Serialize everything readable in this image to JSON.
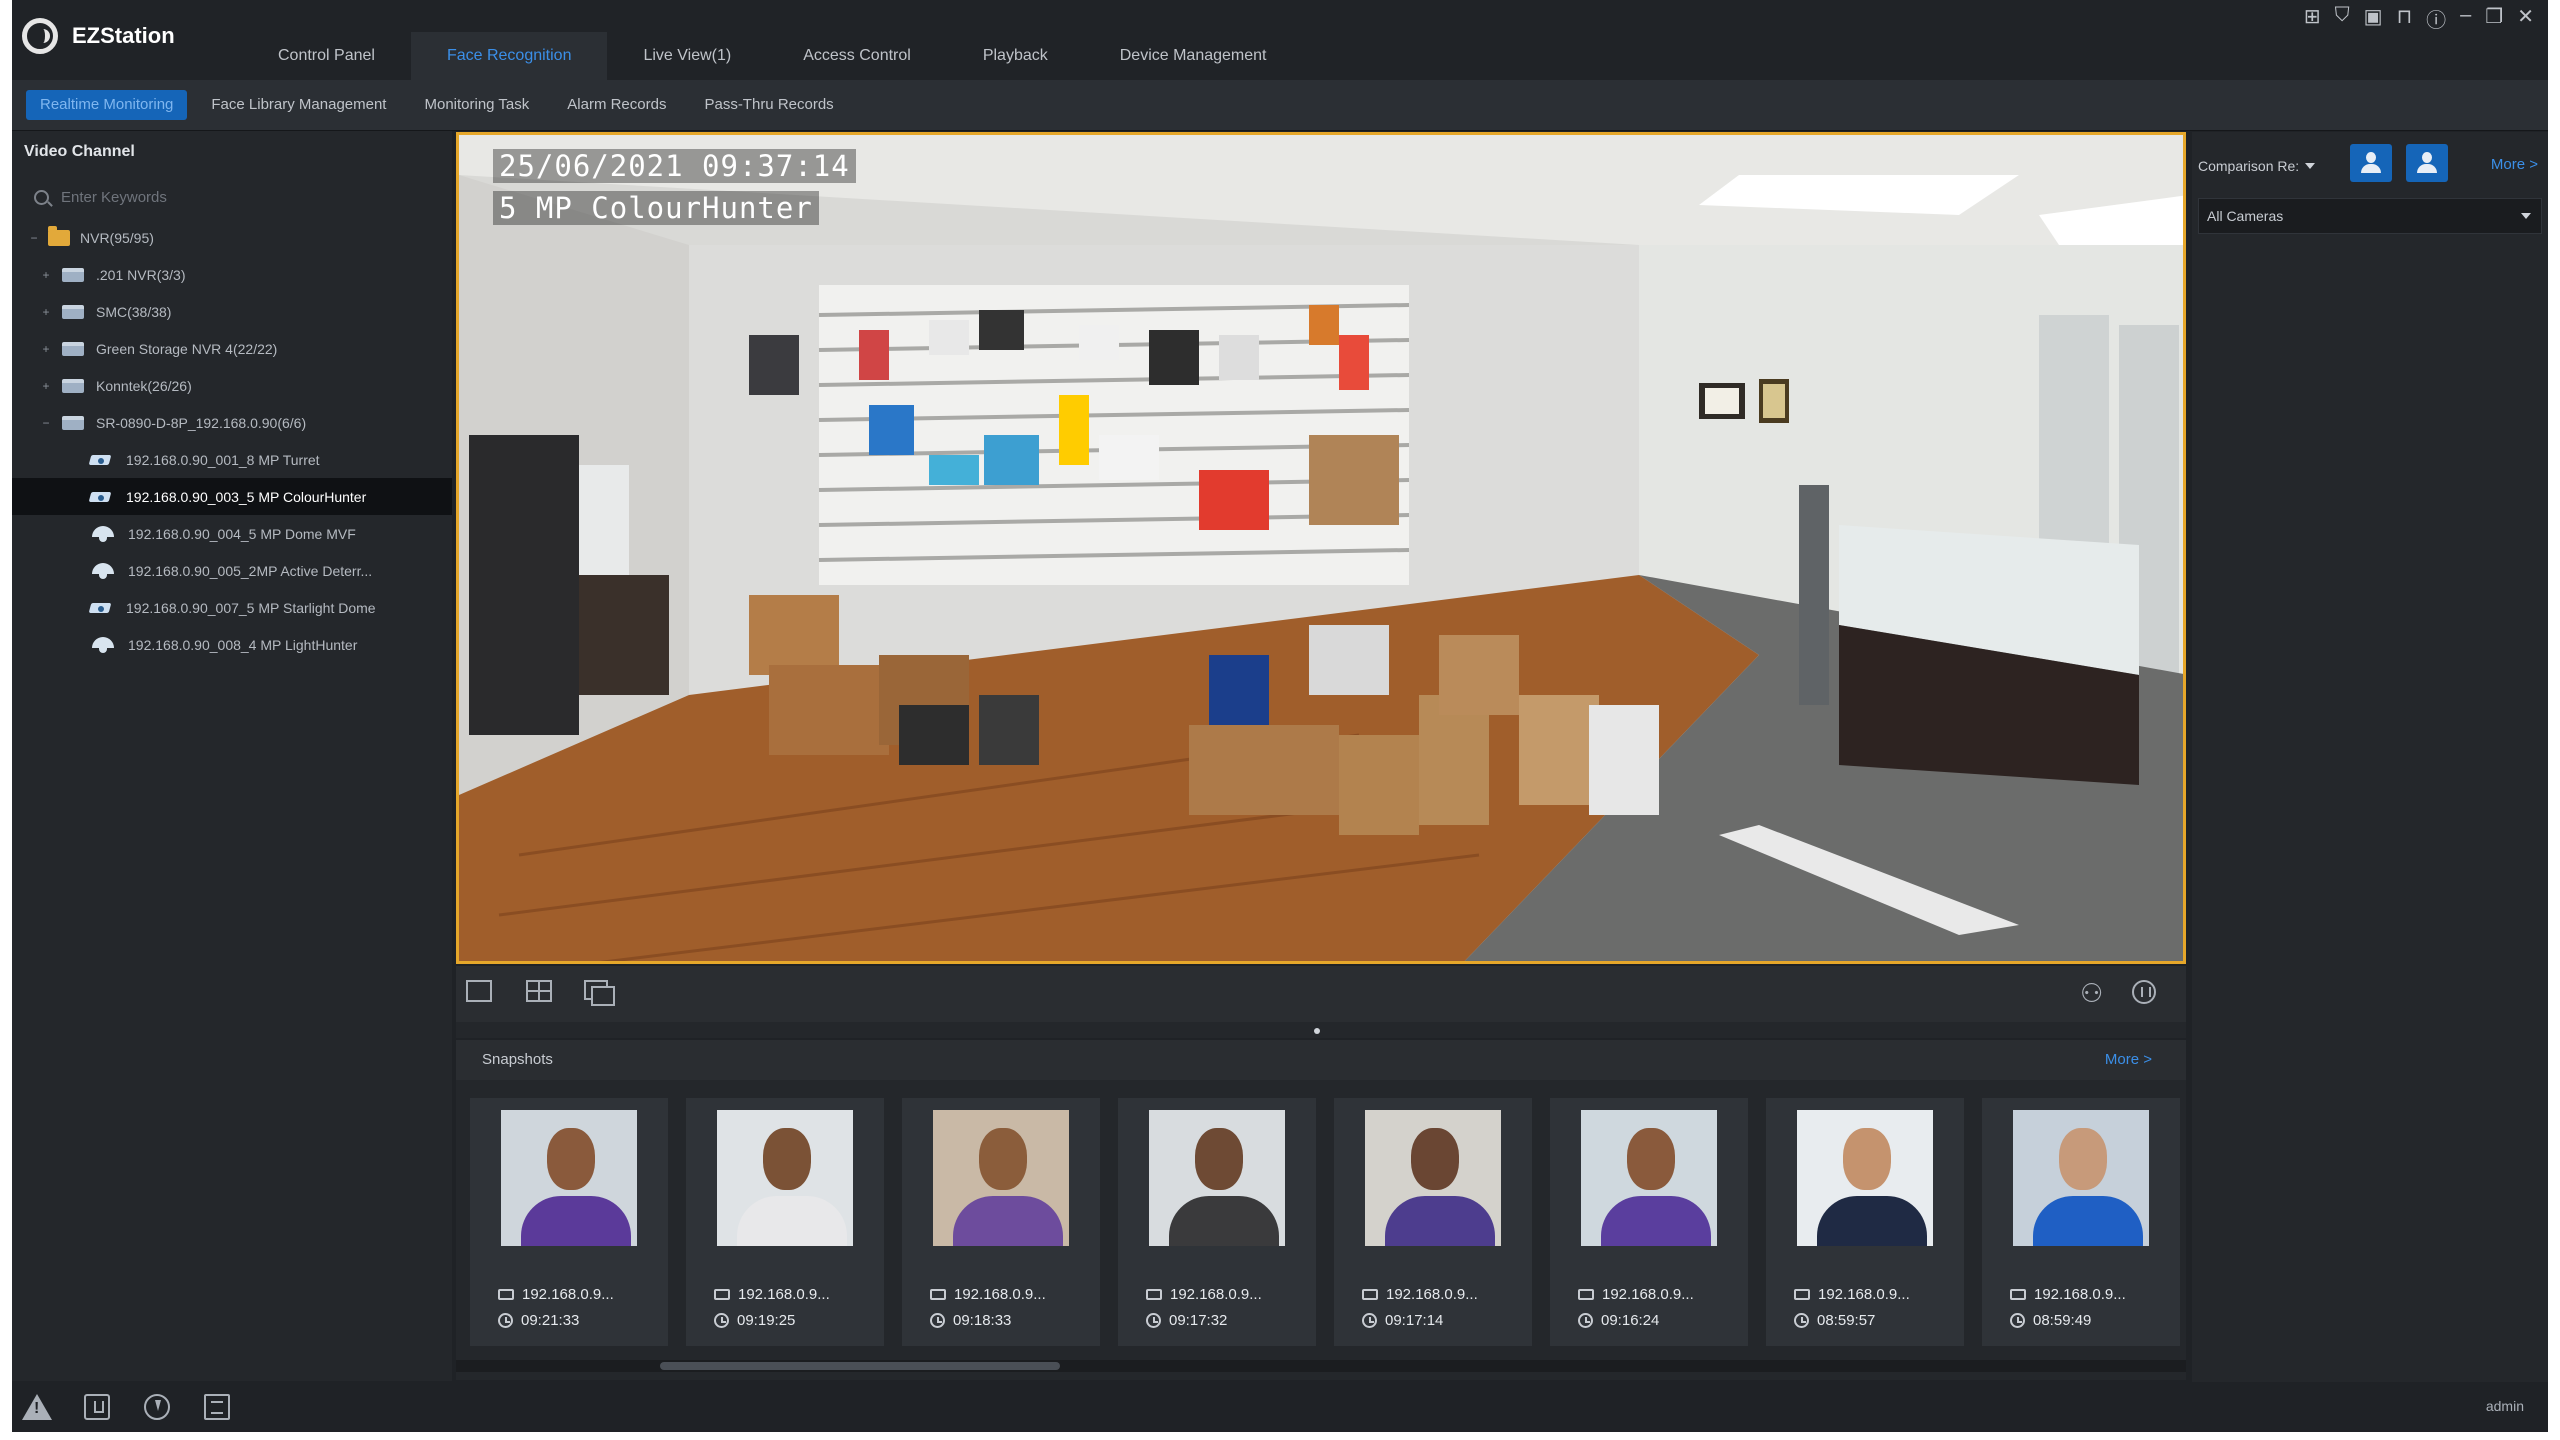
{
  "app": {
    "name": "EZStation",
    "user": "admin"
  },
  "top_tabs": [
    {
      "label": "Control Panel"
    },
    {
      "label": "Face Recognition"
    },
    {
      "label": "Live View(1)"
    },
    {
      "label": "Access Control"
    },
    {
      "label": "Playback"
    },
    {
      "label": "Device Management"
    }
  ],
  "active_top_tab": "Face Recognition",
  "sub_tabs": [
    {
      "label": "Realtime Monitoring"
    },
    {
      "label": "Face Library Management"
    },
    {
      "label": "Monitoring Task"
    },
    {
      "label": "Alarm Records"
    },
    {
      "label": "Pass-Thru Records"
    }
  ],
  "active_sub_tab": "Realtime Monitoring",
  "left_panel": {
    "heading": "Video Channel",
    "search_placeholder": "Enter Keywords",
    "tree": [
      {
        "label": "NVR(95/95)",
        "icon": "folder-icon",
        "level": 0,
        "expander": "−"
      },
      {
        "label": ".201 NVR(3/3)",
        "icon": "nvr-icon",
        "level": 1,
        "expander": "+"
      },
      {
        "label": "SMC(38/38)",
        "icon": "nvr-icon",
        "level": 1,
        "expander": "+"
      },
      {
        "label": "Green Storage NVR 4(22/22)",
        "icon": "nvr-icon",
        "level": 1,
        "expander": "+"
      },
      {
        "label": "Konntek(26/26)",
        "icon": "nvr-icon",
        "level": 1,
        "expander": "+"
      },
      {
        "label": "SR-0890-D-8P_192.168.0.90(6/6)",
        "icon": "nvr-icon",
        "level": 1,
        "expander": "−"
      },
      {
        "label": "192.168.0.90_001_8 MP Turret",
        "icon": "bullet-camera-icon",
        "level": 2
      },
      {
        "label": "192.168.0.90_003_5 MP ColourHunter",
        "icon": "bullet-camera-icon",
        "level": 2,
        "selected": true
      },
      {
        "label": "192.168.0.90_004_5 MP Dome MVF",
        "icon": "dome-camera-icon",
        "level": 2
      },
      {
        "label": "192.168.0.90_005_2MP Active Deterr...",
        "icon": "dome-camera-icon",
        "level": 2
      },
      {
        "label": "192.168.0.90_007_5 MP Starlight Dome",
        "icon": "bullet-camera-icon",
        "level": 2
      },
      {
        "label": "192.168.0.90_008_4 MP LightHunter",
        "icon": "dome-camera-icon",
        "level": 2
      }
    ]
  },
  "video": {
    "timestamp": "25/06/2021 09:37:14",
    "camera_label": "5 MP ColourHunter",
    "border_color": "#e6a72a"
  },
  "video_toolbar": {
    "icons": [
      "single-view-icon",
      "quad-view-icon",
      "multi-window-icon",
      "face-capture-icon",
      "stop-icon"
    ]
  },
  "snapshots": {
    "title": "Snapshots",
    "more": "More >",
    "items": [
      {
        "ip": "192.168.0.9...",
        "time": "09:21:33"
      },
      {
        "ip": "192.168.0.9...",
        "time": "09:19:25"
      },
      {
        "ip": "192.168.0.9...",
        "time": "09:18:33"
      },
      {
        "ip": "192.168.0.9...",
        "time": "09:17:32"
      },
      {
        "ip": "192.168.0.9...",
        "time": "09:17:14"
      },
      {
        "ip": "192.168.0.9...",
        "time": "09:16:24"
      },
      {
        "ip": "192.168.0.9...",
        "time": "08:59:57"
      },
      {
        "ip": "192.168.0.9...",
        "time": "08:59:49"
      }
    ]
  },
  "right_panel": {
    "comparison_label": "Comparison Re:",
    "more": "More >",
    "camera_select": "All Cameras"
  },
  "colors": {
    "accent": "#1565b8",
    "link": "#3b8fe8",
    "background": "#1f2226"
  }
}
